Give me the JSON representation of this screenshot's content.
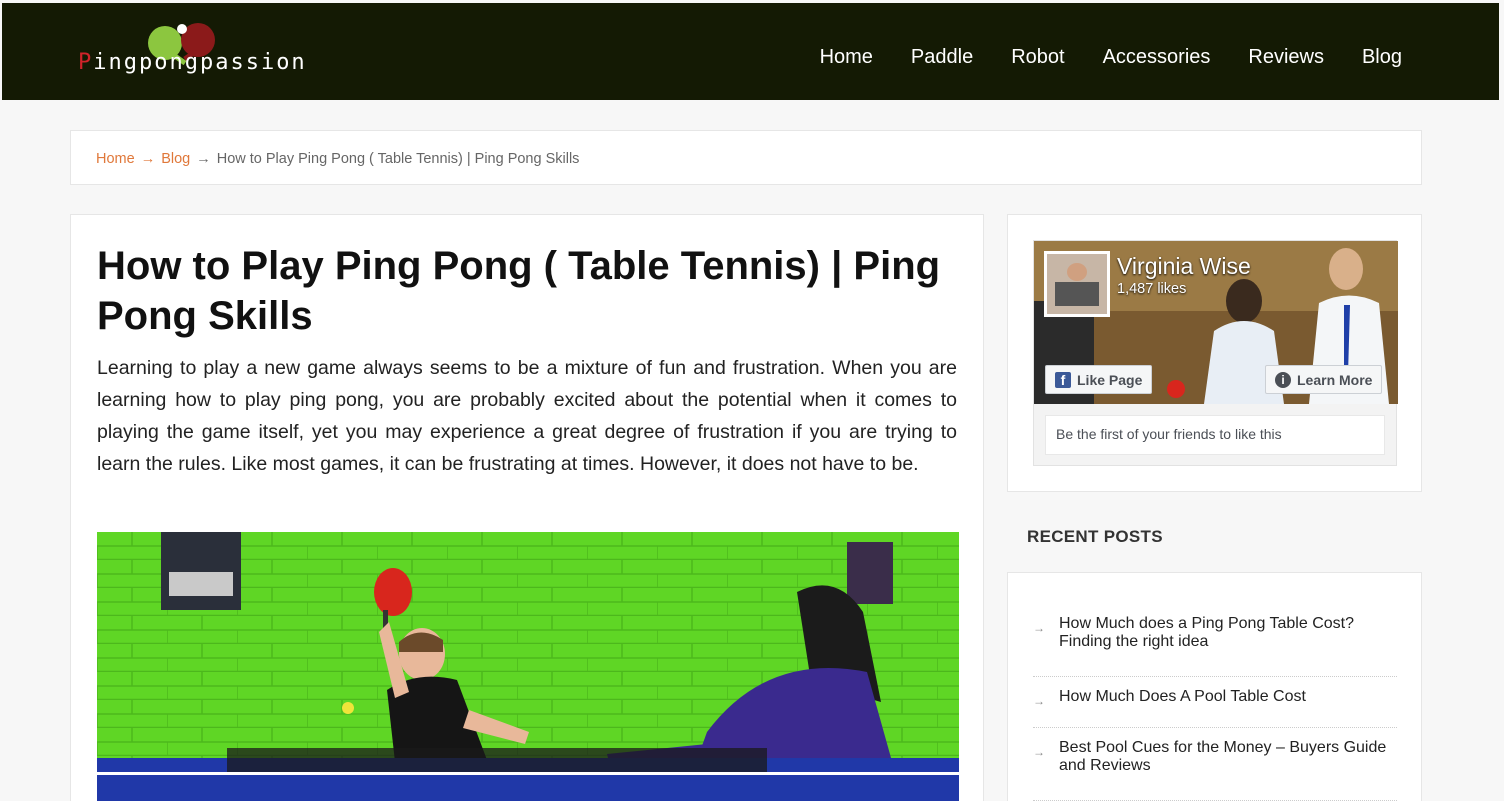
{
  "header": {
    "logo_text_first": "P",
    "logo_text_rest": "ingpongpassion",
    "nav": [
      "Home",
      "Paddle",
      "Robot",
      "Accessories",
      "Reviews",
      "Blog"
    ]
  },
  "breadcrumb": {
    "home": "Home",
    "blog": "Blog",
    "current": "How to Play Ping Pong ( Table Tennis) | Ping Pong Skills",
    "separator": "→"
  },
  "article": {
    "title": "How to Play Ping Pong ( Table Tennis) | Ping Pong Skills",
    "intro": "Learning to play a new game always seems to be a mixture of fun and frustration. When you are learning how to play ping pong, you are probably excited about the potential when it comes to playing the game itself, yet you may experience a great degree of frustration if you are trying to learn the rules. Like most games, it can be frustrating at times. However, it does not have to be."
  },
  "facebook": {
    "page_name": "Virginia Wise",
    "likes": "1,487 likes",
    "like_button": "Like Page",
    "learn_button": "Learn More",
    "friends_text": "Be the first of your friends to like this"
  },
  "recent_posts": {
    "heading": "RECENT POSTS",
    "items": [
      "How Much does a Ping Pong Table Cost? Finding the right idea",
      "How Much Does A Pool Table Cost",
      "Best Pool Cues for the Money – Buyers Guide and Reviews"
    ]
  },
  "colors": {
    "header_bg": "#141a04",
    "link_orange": "#e0783a",
    "logo_red": "#d0232a"
  }
}
